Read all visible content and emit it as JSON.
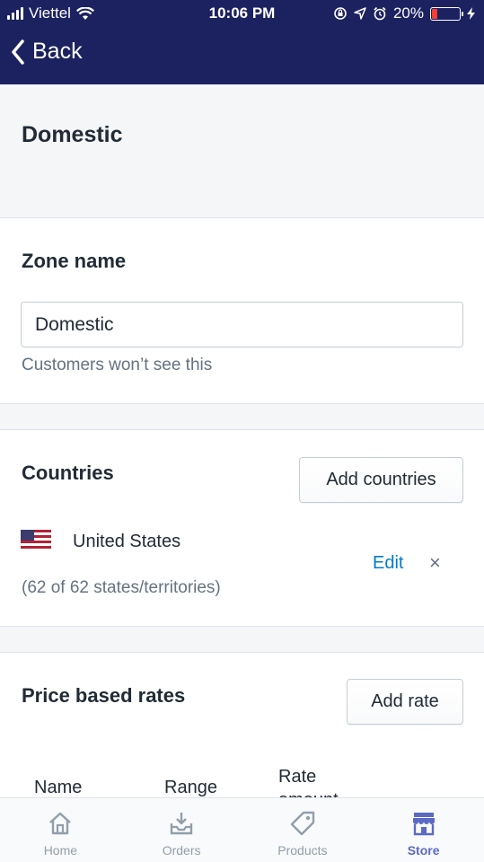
{
  "status_bar": {
    "carrier": "Viettel",
    "time": "10:06 PM",
    "battery": "20%",
    "battery_level": 0.2
  },
  "nav": {
    "back_label": "Back"
  },
  "page": {
    "title": "Domestic"
  },
  "zone": {
    "title": "Zone name",
    "input_value": "Domestic",
    "help": "Customers won’t see this"
  },
  "countries": {
    "title": "Countries",
    "add_button": "Add countries",
    "items": [
      {
        "name": "United States",
        "detail": "(62 of 62 states/territories)",
        "edit": "Edit",
        "remove": "×",
        "flag_icon": "us-flag-icon"
      }
    ]
  },
  "rates": {
    "title": "Price based rates",
    "add_button": "Add rate",
    "columns": [
      "Name",
      "Range",
      "Rate amount"
    ]
  },
  "tabs": [
    {
      "label": "Home",
      "icon": "home-icon",
      "active": false
    },
    {
      "label": "Orders",
      "icon": "orders-icon",
      "active": false
    },
    {
      "label": "Products",
      "icon": "products-icon",
      "active": false
    },
    {
      "label": "Store",
      "icon": "store-icon",
      "active": true
    }
  ],
  "colors": {
    "nav_bg": "#1c2260",
    "link": "#007ace",
    "active_tab": "#5c6ac4",
    "battery_low": "#ff3b30"
  }
}
